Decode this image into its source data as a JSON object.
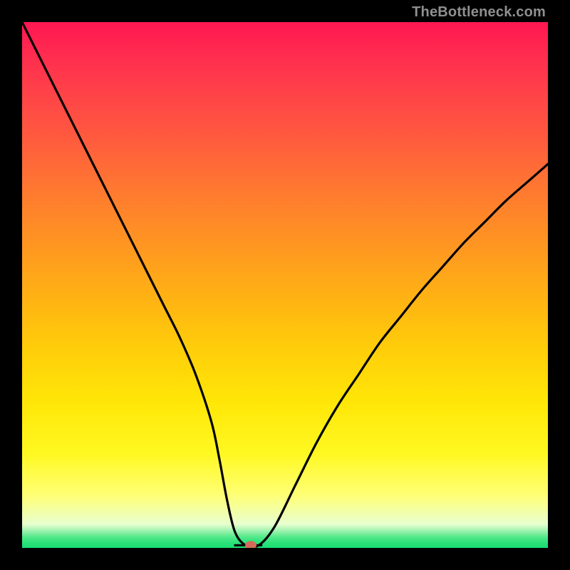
{
  "watermark": "TheBottleneck.com",
  "accent_dot_color": "#d46a5a",
  "curve_color": "#000000",
  "chart_data": {
    "type": "line",
    "title": "",
    "xlabel": "",
    "ylabel": "",
    "xlim": [
      0,
      100
    ],
    "ylim": [
      0,
      100
    ],
    "grid": false,
    "series": [
      {
        "name": "bottleneck-curve",
        "x": [
          0,
          3,
          6,
          9,
          12,
          15,
          18,
          21,
          24,
          27,
          30,
          33,
          36,
          37.5,
          39,
          40.5,
          42.5,
          45,
          48,
          52,
          56,
          60,
          64,
          68,
          72,
          76,
          80,
          84,
          88,
          92,
          96,
          100
        ],
        "y": [
          100,
          94,
          88,
          82,
          76,
          70,
          64,
          58,
          52,
          46,
          40,
          33,
          24,
          17,
          9,
          3,
          0.5,
          0.5,
          4,
          12,
          20,
          27,
          33,
          39,
          44,
          49,
          53.5,
          58,
          62,
          66,
          69.5,
          73
        ]
      },
      {
        "name": "minimum-marker",
        "x": [
          43.5
        ],
        "y": [
          0.5
        ]
      }
    ],
    "flat_bottom": {
      "x_start": 40.5,
      "x_end": 45.5,
      "y": 0.5
    }
  }
}
